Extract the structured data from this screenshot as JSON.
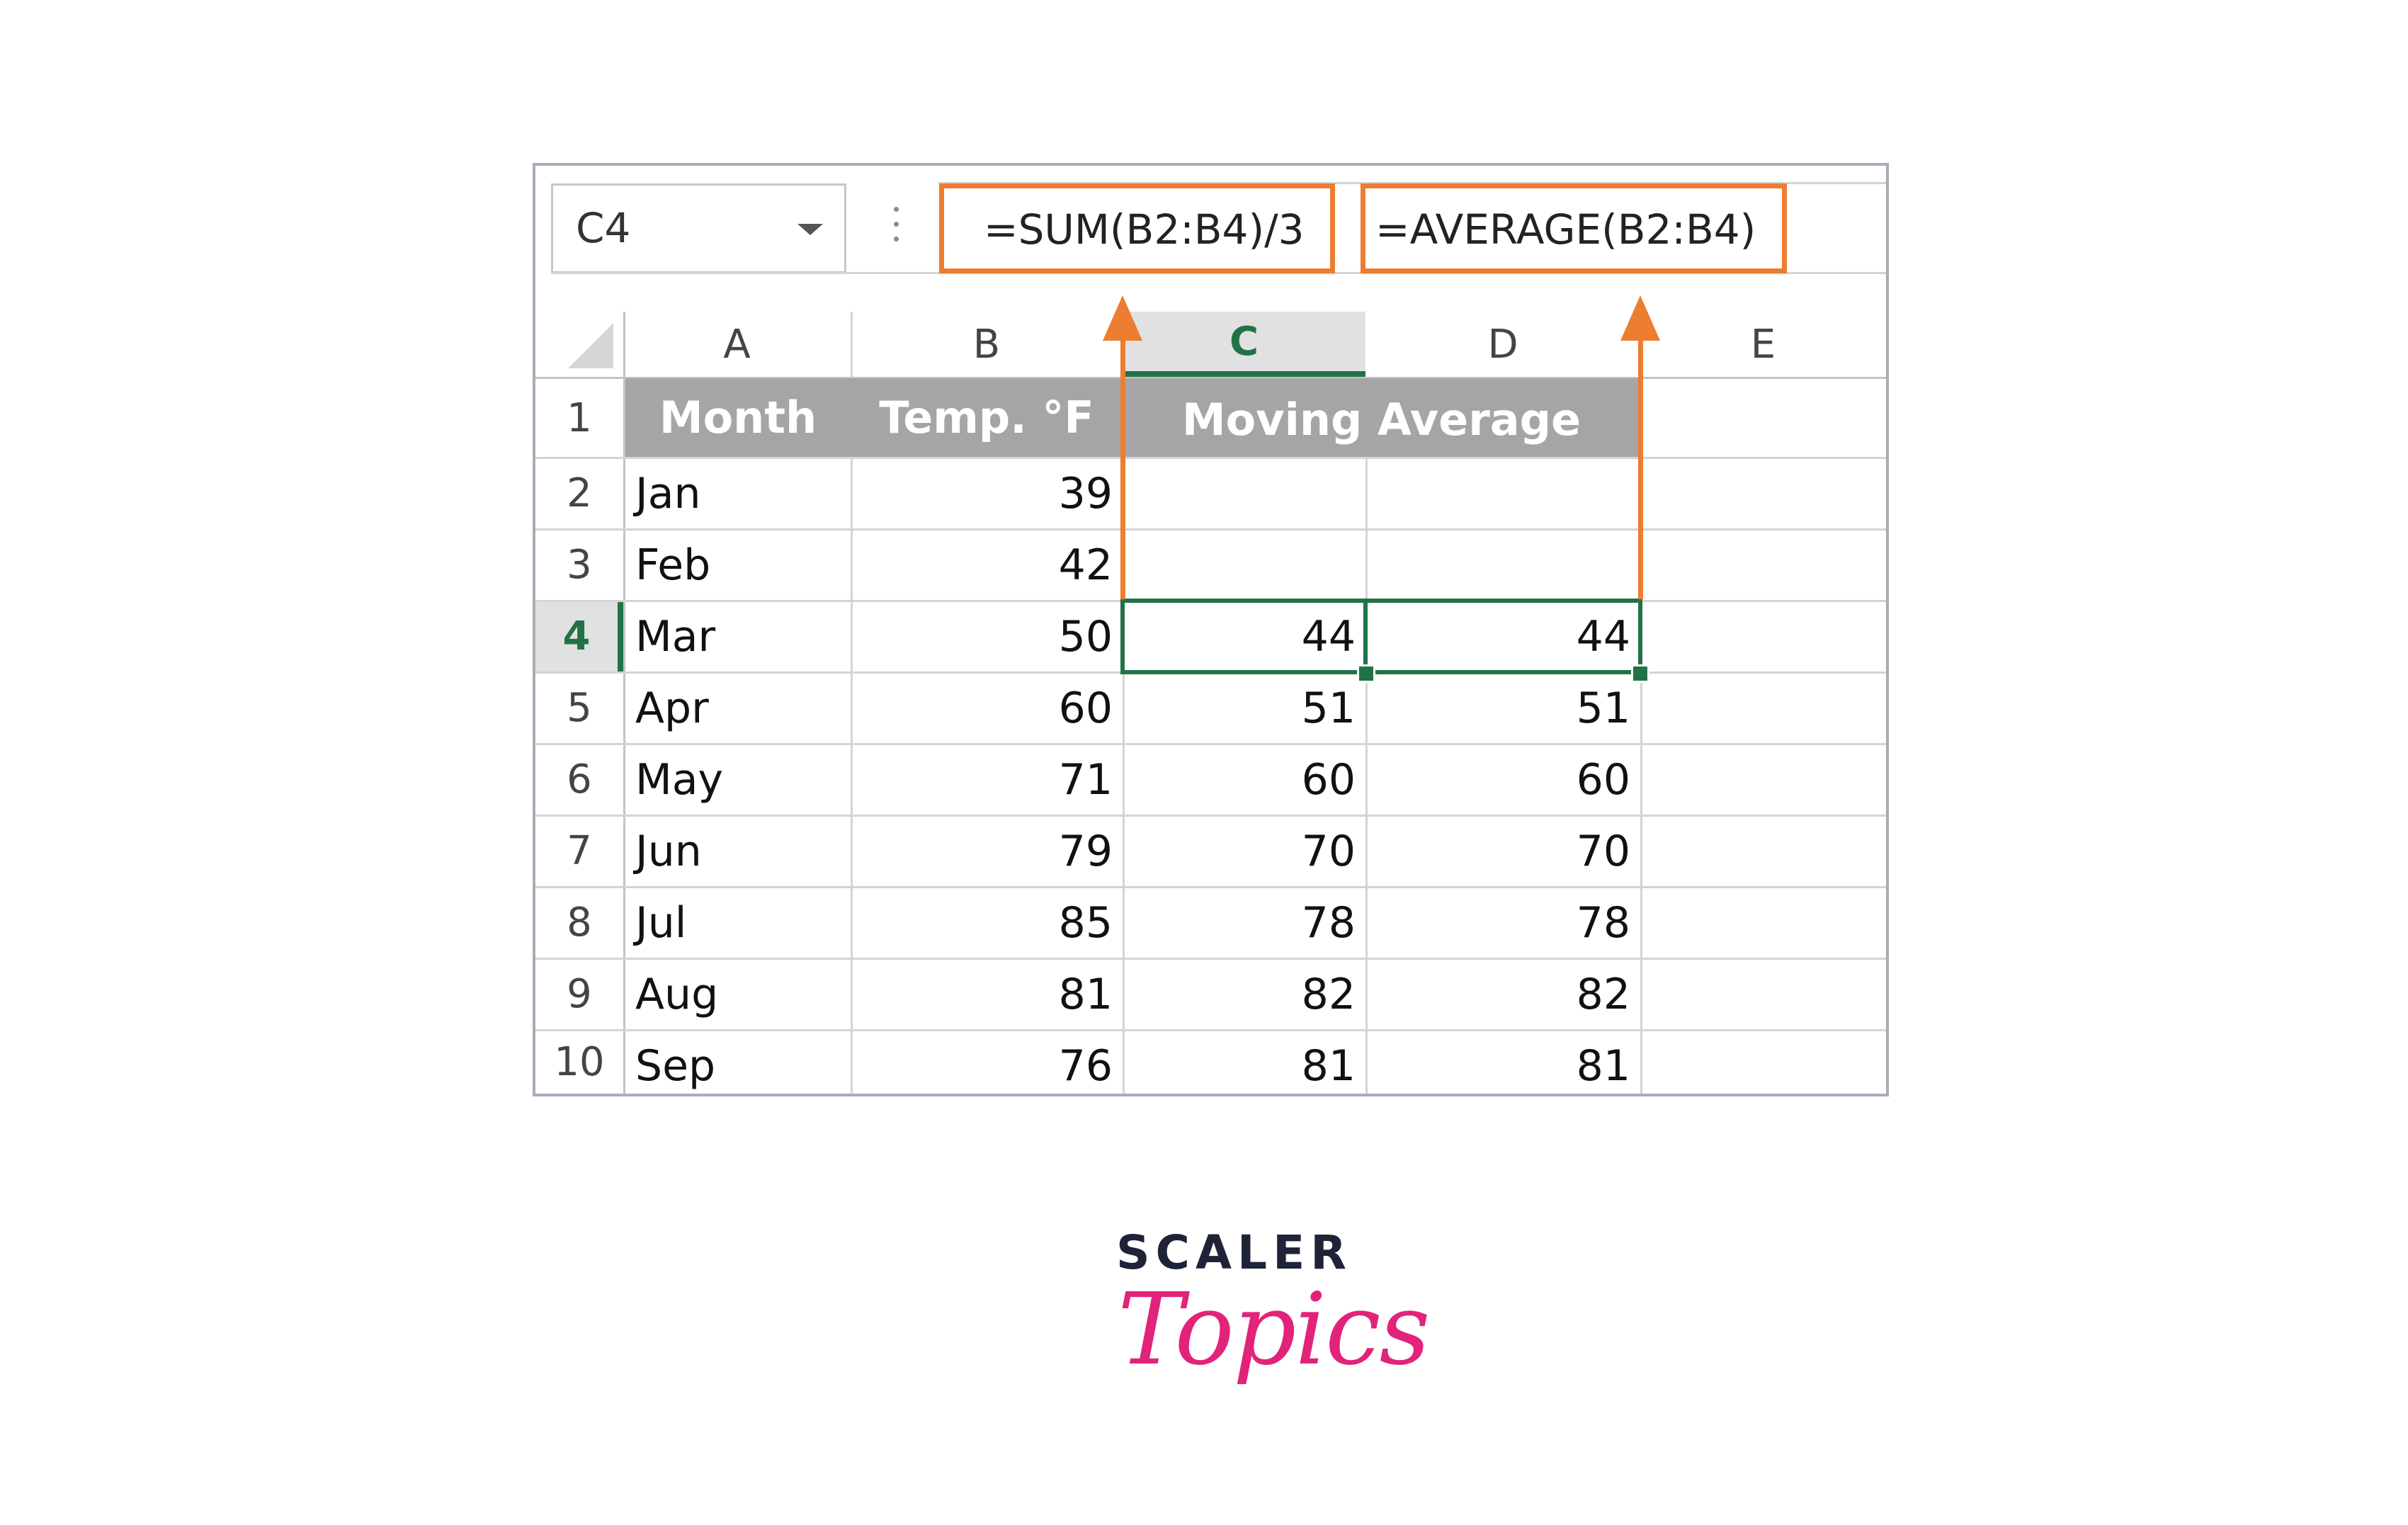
{
  "formula_bar": {
    "name_box": "C4",
    "formula_c": "=SUM(B2:B4)/3",
    "formula_d": "=AVERAGE(B2:B4)"
  },
  "columns": [
    "A",
    "B",
    "C",
    "D",
    "E"
  ],
  "selected_column": "C",
  "rows": [
    "1",
    "2",
    "3",
    "4",
    "5",
    "6",
    "7",
    "8",
    "9",
    "10"
  ],
  "selected_row": "4",
  "header": {
    "month": "Month",
    "temp": "Temp. °F",
    "moving_average": "Moving Average"
  },
  "data_rows": [
    {
      "month": "Jan",
      "temp": "39",
      "c": "",
      "d": ""
    },
    {
      "month": "Feb",
      "temp": "42",
      "c": "",
      "d": ""
    },
    {
      "month": "Mar",
      "temp": "50",
      "c": "44",
      "d": "44"
    },
    {
      "month": "Apr",
      "temp": "60",
      "c": "51",
      "d": "51"
    },
    {
      "month": "May",
      "temp": "71",
      "c": "60",
      "d": "60"
    },
    {
      "month": "Jun",
      "temp": "79",
      "c": "70",
      "d": "70"
    },
    {
      "month": "Jul",
      "temp": "85",
      "c": "78",
      "d": "78"
    },
    {
      "month": "Aug",
      "temp": "81",
      "c": "82",
      "d": "82"
    },
    {
      "month": "Sep",
      "temp": "76",
      "c": "81",
      "d": "81"
    }
  ],
  "logo": {
    "top": "SCALER",
    "bottom": "Topics"
  },
  "colors": {
    "accent_orange": "#ed7d31",
    "excel_green": "#217346",
    "header_gray": "#a5a5a5",
    "logo_pink": "#e2237a",
    "logo_navy": "#1f2338"
  }
}
